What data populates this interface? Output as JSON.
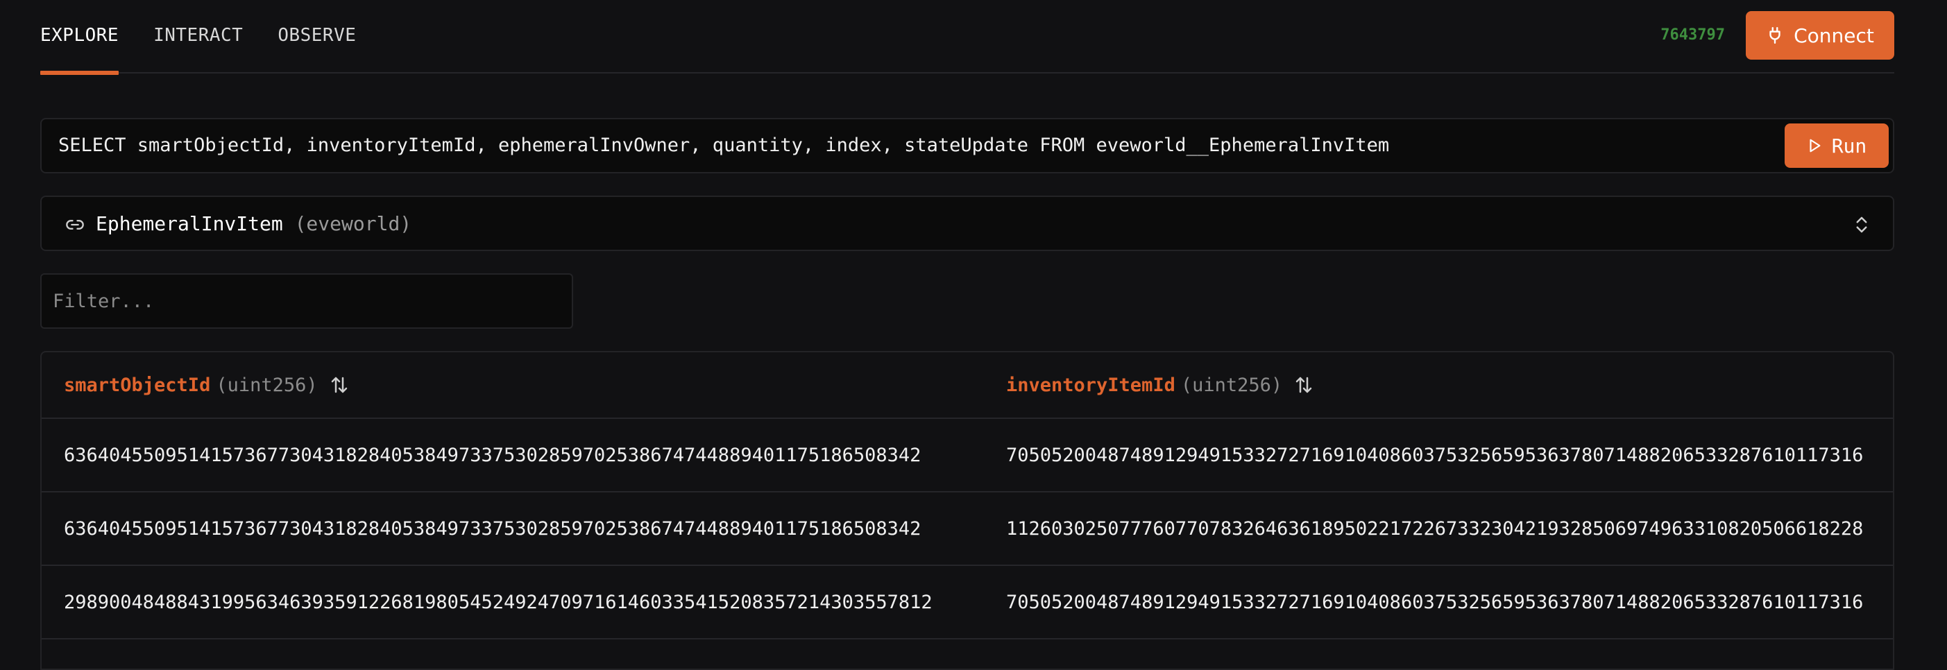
{
  "header": {
    "tabs": [
      {
        "label": "EXPLORE",
        "active": true
      },
      {
        "label": "INTERACT",
        "active": false
      },
      {
        "label": "OBSERVE",
        "active": false
      }
    ],
    "block_number": "7643797",
    "connect_label": "Connect",
    "connect_icon": "plug-icon"
  },
  "query": {
    "text": "SELECT smartObjectId, inventoryItemId, ephemeralInvOwner, quantity, index, stateUpdate FROM eveworld__EphemeralInvItem",
    "run_label": "Run",
    "run_icon": "play-icon"
  },
  "table_selector": {
    "name": "EphemeralInvItem",
    "namespace": "(eveworld)",
    "icon": "link-icon",
    "chevron_icon": "chevron-up-down-icon"
  },
  "filter": {
    "placeholder": "Filter...",
    "value": ""
  },
  "table": {
    "columns": [
      {
        "name": "smartObjectId",
        "type": "(uint256)"
      },
      {
        "name": "inventoryItemId",
        "type": "(uint256)"
      }
    ],
    "rows": [
      [
        "63640455095141573677304318284053849733753028597025386747448894011751865083​42",
        "70505200487489129491533272716910408603753256595363780714882065332876101173​16"
      ],
      [
        "6364045509514157367730431828405384973375302859702538674744889401175186508342",
        "1126030250777607707832646361895022172267332304219328506974963310820506618228"
      ],
      [
        "2989004848843199563463935912268198054524924709716146033541520835721430355781​2",
        "7050520048748912949153327271691040860375325659536378071488206533287610117316"
      ]
    ],
    "colors": {
      "accent": "#e0652e",
      "block_number": "#3f8f3f",
      "background": "#111113"
    }
  }
}
